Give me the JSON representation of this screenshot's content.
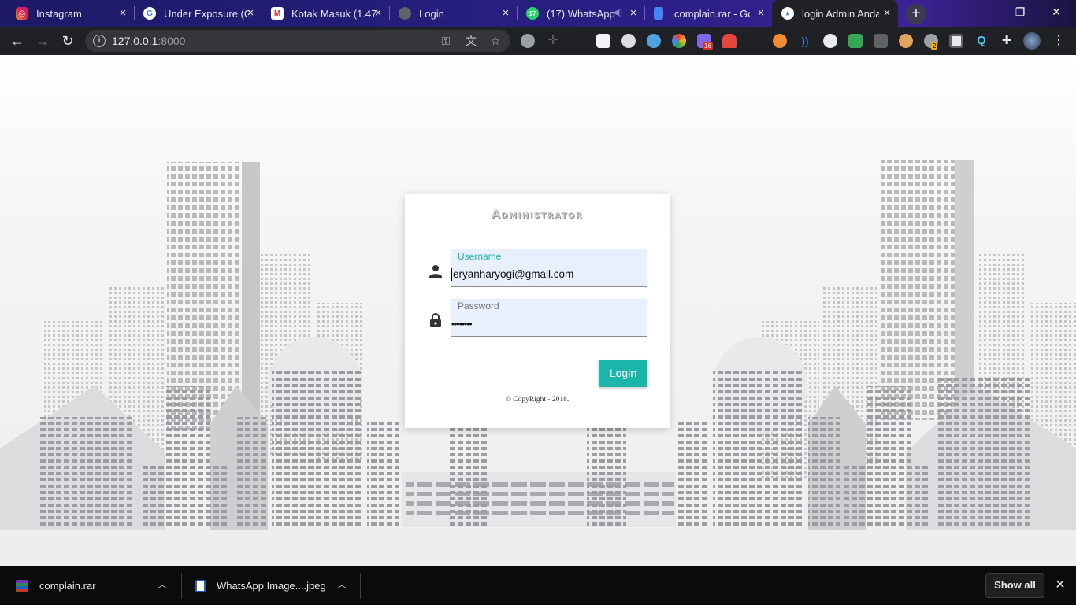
{
  "tabs": [
    {
      "title": "Instagram",
      "icon": "instagram-icon"
    },
    {
      "title": "Under Exposure (G",
      "icon": "google-icon"
    },
    {
      "title": "Kotak Masuk (1.47",
      "icon": "gmail-icon"
    },
    {
      "title": "Login",
      "icon": "globe-icon"
    },
    {
      "title": "(17) WhatsApp",
      "icon": "whatsapp-icon",
      "badge": "17"
    },
    {
      "title": "complain.rar - Goo",
      "icon": "docs-icon"
    },
    {
      "title": "login Admin Anda",
      "icon": "site-logo-icon"
    }
  ],
  "toolbar": {
    "url_host": "127.0.0.1",
    "url_port": ":8000",
    "extension_badges": [
      "16",
      "2"
    ]
  },
  "login": {
    "title": "Administrator",
    "username_label": "Username",
    "username_value": "eryanharyogi@gmail.com",
    "password_label": "Password",
    "password_value": "••••••••",
    "button_label": "Login",
    "copyright": "© CopyRight - 2018."
  },
  "downloads": {
    "items": [
      {
        "name": "complain.rar"
      },
      {
        "name": "WhatsApp Image....jpeg"
      }
    ],
    "show_all": "Show all"
  },
  "colors": {
    "accent": "#1bb5a9",
    "field_bg": "#e8f0fe",
    "tabbar": "#2a1f86"
  }
}
